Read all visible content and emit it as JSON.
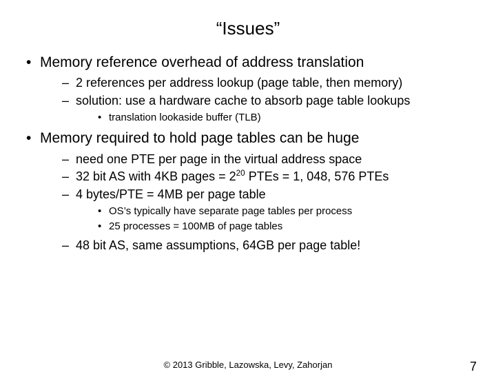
{
  "title": "“Issues”",
  "b1": {
    "text": "Memory reference overhead of address translation",
    "s1": "2 references per address lookup (page table, then memory)",
    "s2": "solution: use a hardware cache to absorb page table lookups",
    "s2a": "translation lookaside buffer (TLB)"
  },
  "b2": {
    "text": "Memory required to hold page tables can be huge",
    "s1": "need one PTE per page in the virtual address space",
    "s2_pre": "32 bit AS with 4",
    "s2_mid": "KB pages = 2",
    "s2_exp": "20",
    "s2_post": " PTEs = 1,",
    "s2_post2": "048,",
    "s2_post3": "576 PTEs",
    "s3_pre": "4 bytes/PTE = 4",
    "s3_post": "MB per page table",
    "s3a": "OS’s typically have separate page tables per process",
    "s3b_pre": "25 processes = 100",
    "s3b_post": "MB of page tables",
    "s4_pre": "48 bit AS, same assumptions, 64",
    "s4_post": "GB per page table!"
  },
  "footer": {
    "copyright": "© 2013 Gribble, Lazowska, Levy, Zahorjan",
    "page": "7"
  }
}
